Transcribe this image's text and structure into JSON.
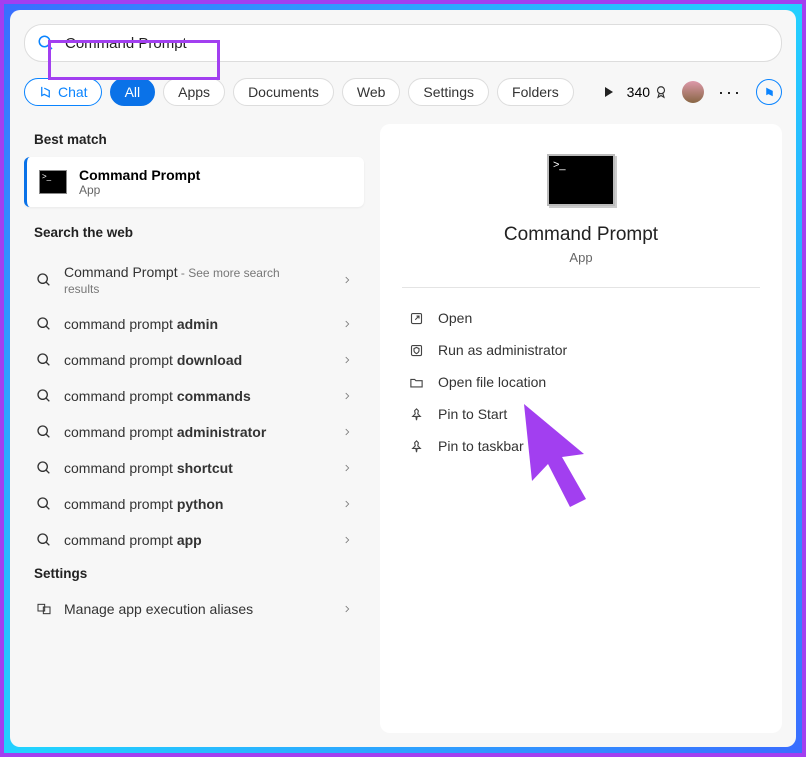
{
  "search": {
    "value": "Command Prompt"
  },
  "tabs": {
    "chat": "Chat",
    "items": [
      "All",
      "Apps",
      "Documents",
      "Web",
      "Settings",
      "Folders"
    ]
  },
  "rewards": "340",
  "left": {
    "best_match": "Best match",
    "best": {
      "title": "Command Prompt",
      "sub": "App"
    },
    "search_web": "Search the web",
    "web": [
      {
        "pre": "Command Prompt",
        "bold": "",
        "suf": " - See more search results",
        "subline": true
      },
      {
        "pre": "command prompt ",
        "bold": "admin"
      },
      {
        "pre": "command prompt ",
        "bold": "download"
      },
      {
        "pre": "command prompt ",
        "bold": "commands"
      },
      {
        "pre": "command prompt ",
        "bold": "administrator"
      },
      {
        "pre": "command prompt ",
        "bold": "shortcut"
      },
      {
        "pre": "command prompt ",
        "bold": "python"
      },
      {
        "pre": "command prompt ",
        "bold": "app"
      }
    ],
    "settings_h": "Settings",
    "settings_item": "Manage app execution aliases"
  },
  "detail": {
    "title": "Command Prompt",
    "sub": "App",
    "actions": [
      {
        "icon": "open",
        "label": "Open"
      },
      {
        "icon": "shield",
        "label": "Run as administrator"
      },
      {
        "icon": "folder",
        "label": "Open file location"
      },
      {
        "icon": "pin",
        "label": "Pin to Start"
      },
      {
        "icon": "pin",
        "label": "Pin to taskbar"
      }
    ]
  }
}
